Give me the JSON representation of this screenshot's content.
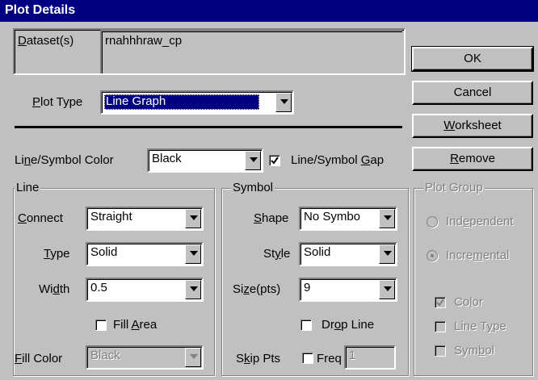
{
  "title": "Plot Details",
  "dataset": {
    "label": "Dataset(s)",
    "value": "rnahhhraw_cp"
  },
  "plot_type": {
    "label": "Plot Type",
    "value": "Line Graph"
  },
  "color_row": {
    "label": "Line/Symbol Color",
    "value": "Black",
    "gap_label": "Line/Symbol Gap",
    "gap_checked": true
  },
  "buttons": {
    "ok": "OK",
    "cancel": "Cancel",
    "worksheet": "Worksheet",
    "remove": "Remove"
  },
  "line": {
    "group_label": "Line",
    "connect_label": "Connect",
    "connect_value": "Straight",
    "type_label": "Type",
    "type_value": "Solid",
    "width_label": "Width",
    "width_value": "0.5",
    "fill_area_label": "Fill Area",
    "fill_color_label": "Fill Color",
    "fill_color_value": "Black"
  },
  "symbol": {
    "group_label": "Symbol",
    "shape_label": "Shape",
    "shape_value": "No Symbo",
    "style_label": "Style",
    "style_value": "Solid",
    "size_label": "Size(pts)",
    "size_value": "9",
    "drop_line_label": "Drop Line",
    "skip_label": "Skip Pts",
    "freq_label": "Freq",
    "freq_value": "1"
  },
  "plot_group": {
    "group_label": "Plot Group",
    "independent_label": "Independent",
    "incremental_label": "Incremental",
    "color_label": "Color",
    "color_checked": true,
    "line_type_label": "Line Type",
    "symbol_label": "Symbol"
  },
  "colors": {
    "title_bar": "#000080",
    "selection": "#000080",
    "face": "#c0c0c0"
  }
}
